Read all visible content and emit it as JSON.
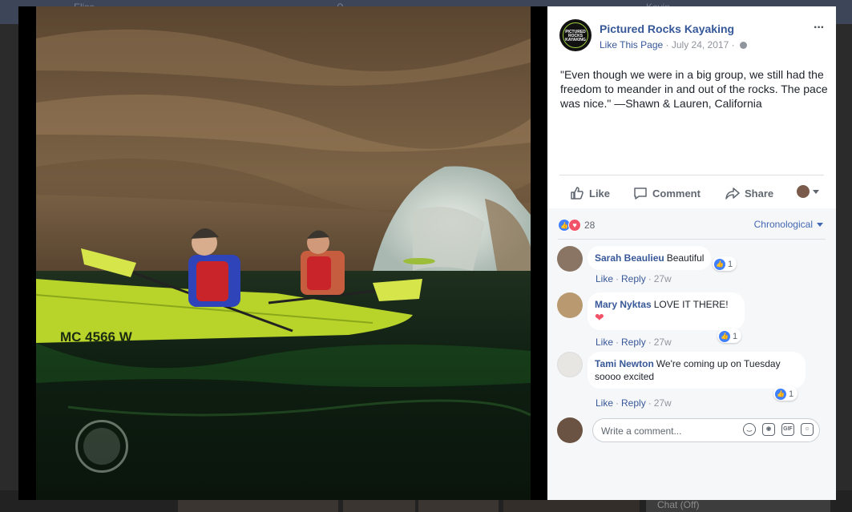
{
  "colors": {
    "link": "#365899",
    "accent": "#4267b2",
    "like_blue": "#4080ff",
    "love_red": "#f25268"
  },
  "background": {
    "search_placeholder": "Elise",
    "user_name": "Kevin",
    "chat_label": "Chat (Off)"
  },
  "post": {
    "page_name": "Pictured Rocks Kayaking",
    "avatar_text": "PICTURED ROCKS KAYAKING",
    "like_page": "Like This Page",
    "separator": "·",
    "date": "July 24, 2017",
    "privacy_icon": "globe-icon",
    "more_icon": "···",
    "text": "\"Even though we were in a big group, we still had the freedom to meander in and out of the rocks. The pace was nice.\"  —Shawn & Lauren, California"
  },
  "actions": {
    "like": "Like",
    "comment": "Comment",
    "share": "Share"
  },
  "reactions": {
    "count": "28",
    "sort": "Chronological"
  },
  "comments": [
    {
      "author": "Sarah Beaulieu",
      "text": "Beautiful",
      "likes": "1",
      "like": "Like",
      "reply": "Reply",
      "time": "27w"
    },
    {
      "author": "Mary Nyktas",
      "text": "LOVE IT THERE!",
      "emoji": "❤",
      "likes": "1",
      "like": "Like",
      "reply": "Reply",
      "time": "27w"
    },
    {
      "author": "Tami Newton",
      "text": "We're coming up on Tuesday soooo excited",
      "likes": "1",
      "like": "Like",
      "reply": "Reply",
      "time": "27w"
    }
  ],
  "composer": {
    "placeholder": "Write a comment...",
    "gif_label": "GIF"
  }
}
